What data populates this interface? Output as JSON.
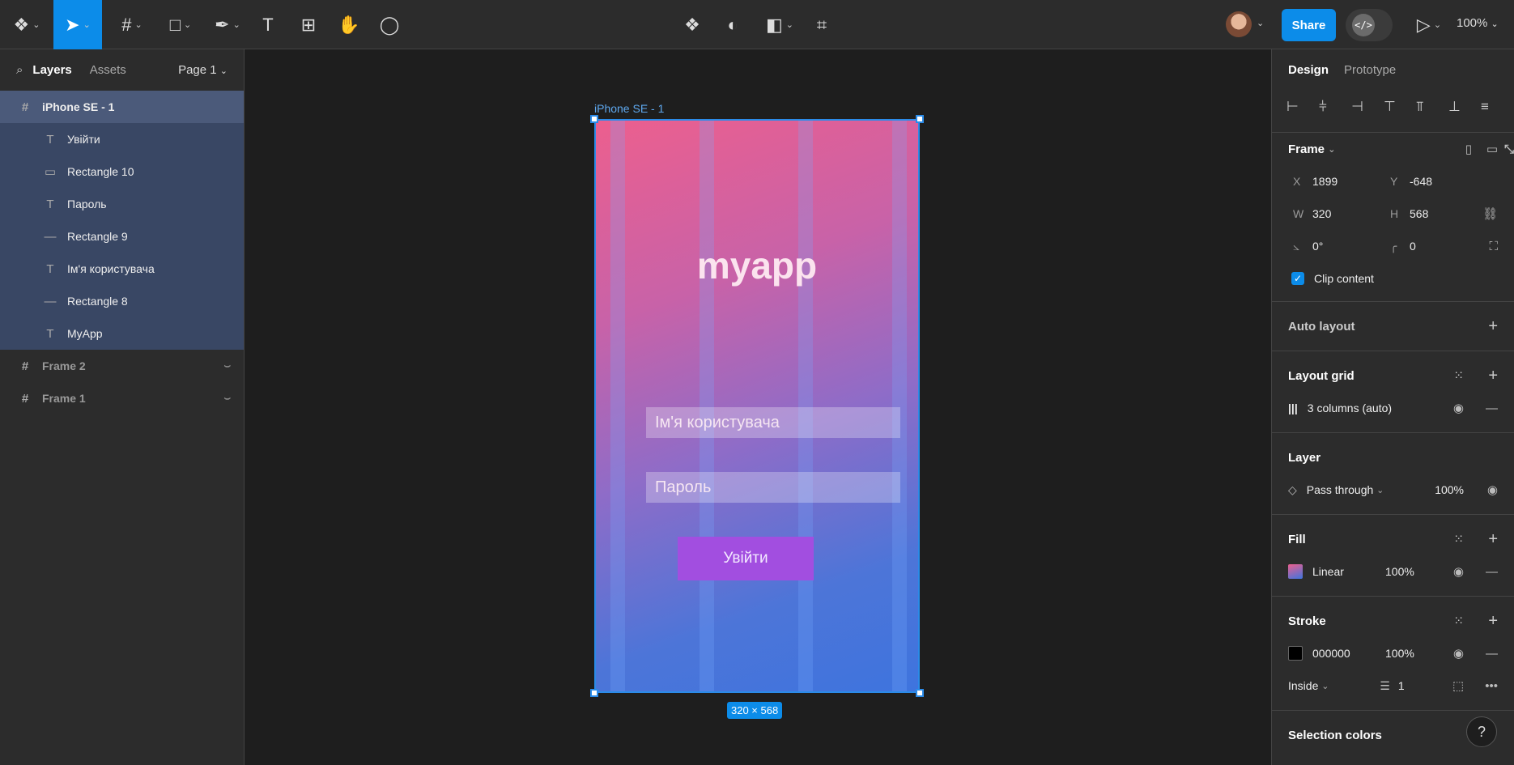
{
  "toolbar": {
    "menu_icon": "figma-logo-icon",
    "tools": [
      "move",
      "frame",
      "rectangle",
      "pen",
      "text",
      "resources",
      "hand",
      "comment"
    ],
    "center_tools": [
      "component",
      "contrast",
      "boolean",
      "crop"
    ],
    "share_label": "Share",
    "devmode_label": "</>",
    "zoom": "100%"
  },
  "left_panel": {
    "tabs": [
      "Layers",
      "Assets"
    ],
    "page": "Page 1",
    "selected_frame": "iPhone SE - 1",
    "children": [
      {
        "type": "text",
        "name": "Увійти"
      },
      {
        "type": "rect",
        "name": "Rectangle 10"
      },
      {
        "type": "text",
        "name": "Пароль"
      },
      {
        "type": "line",
        "name": "Rectangle 9"
      },
      {
        "type": "text",
        "name": "Ім'я користувача"
      },
      {
        "type": "line",
        "name": "Rectangle 8"
      },
      {
        "type": "text",
        "name": "MyApp"
      }
    ],
    "hidden_frames": [
      "Frame 2",
      "Frame 1"
    ]
  },
  "canvas": {
    "frame_label": "iPhone SE - 1",
    "app_title": "myapp",
    "username_placeholder": "Ім'я користувача",
    "password_placeholder": "Пароль",
    "login_label": "Увійти",
    "size_badge": "320 × 568"
  },
  "right_panel": {
    "tabs": [
      "Design",
      "Prototype"
    ],
    "frame_label": "Frame",
    "x": "1899",
    "y": "-648",
    "w": "320",
    "h": "568",
    "rotation": "0°",
    "radius": "0",
    "clip_content": "Clip content",
    "auto_layout": "Auto layout",
    "layout_grid": "Layout grid",
    "grid_value": "3 columns (auto)",
    "layer": "Layer",
    "blend": "Pass through",
    "layer_opacity": "100%",
    "fill": "Fill",
    "fill_type": "Linear",
    "fill_opacity": "100%",
    "stroke": "Stroke",
    "stroke_color": "000000",
    "stroke_opacity": "100%",
    "stroke_position": "Inside",
    "stroke_weight": "1",
    "selection_colors": "Selection colors"
  },
  "colors": {
    "accent": "#0c8ce9",
    "selection_bg": "#394764",
    "gradient_top": "#ec5f8e",
    "gradient_bottom": "#3e74de",
    "button": "#a24ee0"
  }
}
